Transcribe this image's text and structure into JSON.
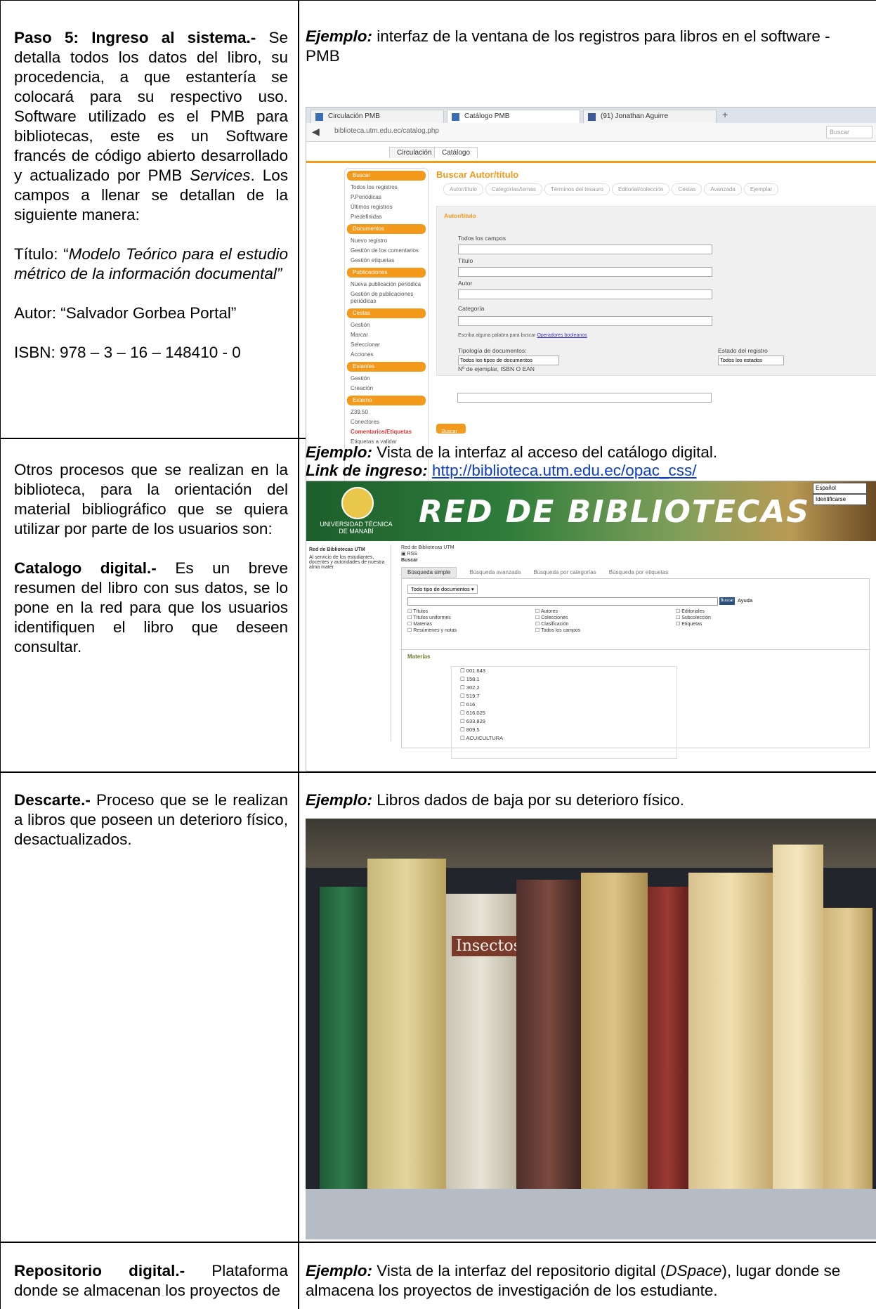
{
  "rows": [
    {
      "left": {
        "heading": "Paso 5: Ingreso al sistema.-",
        "text1": "Se detalla todos los datos del libro, su procedencia, a que estantería se colocará para su respectivo uso. Software utilizado es el PMB para bibliotecas, este es un Software francés de código abierto desarrollado y actualizado por PMB ",
        "text1_italic": "Services",
        "text1_end": ". Los campos a llenar se detallan de la siguiente manera:",
        "titulo_label": "Título: “",
        "titulo_value": "Modelo Teórico para el estudio métrico de la información documental”",
        "autor": "Autor: “Salvador Gorbea Portal”",
        "isbn": "ISBN: 978 – 3 – 16 – 148410 - 0"
      },
      "right": {
        "ex_label": "Ejemplo:",
        "ex_text": " interfaz de la ventana de los registros para libros en el software - PMB"
      }
    },
    {
      "left": {
        "intro": "Otros procesos que se realizan en la biblioteca, para la orientación del material bibliográfico que se quiera utilizar por parte de los usuarios son:",
        "heading": "Catalogo digital.-",
        "text": " Es un breve resumen del libro con sus datos, se lo pone en la red para que los usuarios identifiquen el libro que deseen consultar."
      },
      "right": {
        "ex_label": "Ejemplo:",
        "ex_text": " Vista de la interfaz al acceso del catálogo digital.",
        "link_label": "Link de ingreso:",
        "link": "http://biblioteca.utm.edu.ec/opac_css/"
      }
    },
    {
      "left": {
        "heading": "Descarte.-",
        "text": " Proceso que se le realizan a libros que poseen un deterioro físico, desactualizados."
      },
      "right": {
        "ex_label": "Ejemplo:",
        "ex_text": " Libros dados de baja por su deterioro físico."
      }
    },
    {
      "left": {
        "heading": "Repositorio digital.-",
        "text": " Plataforma donde se almacenan los proyectos de"
      },
      "right": {
        "ex_label": "Ejemplo:",
        "ex_text1": " Vista de la interfaz del repositorio digital (",
        "ex_italic": "DSpace",
        "ex_text2": "), lugar donde se almacena los proyectos de investigación de los estudiante."
      }
    }
  ],
  "pmb": {
    "browser_tabs": [
      "Circulación PMB",
      "Catálogo PMB",
      "(91) Jonathan Aguirre"
    ],
    "url": "biblioteca.utm.edu.ec/catalog.php",
    "search_placeholder": "Buscar",
    "top_tabs": [
      "Circulación",
      "Catálogo"
    ],
    "sidebar": [
      {
        "type": "h",
        "label": "Buscar"
      },
      {
        "type": "i",
        "label": "Todos los registros"
      },
      {
        "type": "i",
        "label": "P.Periódicas"
      },
      {
        "type": "i",
        "label": "Últimos registros"
      },
      {
        "type": "i",
        "label": "Predefinidas"
      },
      {
        "type": "h",
        "label": "Documentos"
      },
      {
        "type": "i",
        "label": "Nuevo registro"
      },
      {
        "type": "i",
        "label": "Gestión de los comentarios"
      },
      {
        "type": "i",
        "label": "Gestión etiquetas"
      },
      {
        "type": "h",
        "label": "Publicaciones"
      },
      {
        "type": "i",
        "label": "Nueva publicación periódica"
      },
      {
        "type": "i",
        "label": "Gestión de publicaciones periódicas"
      },
      {
        "type": "h",
        "label": "Cestas"
      },
      {
        "type": "i",
        "label": "Gestión"
      },
      {
        "type": "i",
        "label": "Marcar"
      },
      {
        "type": "i",
        "label": "Seleccionar"
      },
      {
        "type": "i",
        "label": "Acciones"
      },
      {
        "type": "h",
        "label": "Estantes"
      },
      {
        "type": "i",
        "label": "Gestión"
      },
      {
        "type": "i",
        "label": "Creación"
      },
      {
        "type": "h",
        "label": "Externo"
      },
      {
        "type": "i",
        "label": "Z39.50"
      },
      {
        "type": "i",
        "label": "Conectores"
      },
      {
        "type": "r",
        "label": "Comentarios/Etiquetas"
      },
      {
        "type": "i",
        "label": "Etiquetas a validar"
      }
    ],
    "title": "Buscar Autor/título",
    "subtabs": [
      "Autor/título",
      "Categorías/temas",
      "Términos del tesauro",
      "Editorial/colección",
      "Cestas",
      "Avanzada",
      "Ejemplar"
    ],
    "panel_title": "Autor/título",
    "fields": [
      "Todos los campos",
      "Título",
      "Autor",
      "Categoría"
    ],
    "hint": "Escriba alguna palabra para buscar",
    "hint_link": "Operadores booleanos",
    "tipologia_label": "Tipología de documentos:",
    "tipologia_value": "Todos los tipos de documentos",
    "estado_label": "Estado del registro",
    "estado_value": "Todos los estados",
    "ejemplar_label": "Nº de ejemplar, ISBN O EAN",
    "search_button": "Buscar"
  },
  "opac": {
    "lang": "Español",
    "ident": "Identificarse",
    "logo_text": "UNIVERSIDAD TÉCNICA DE MANABÍ",
    "banner_title": "RED DE BIBLIOTECAS",
    "left_title": "Red de Bibliotecas UTM",
    "left_text": "Al servicio de los estudiantes, docentes y autoridades de nuestra alma mater",
    "crumb1": "Red de Bibliotecas UTM",
    "crumb2": "RSS",
    "crumb3": "Buscar",
    "tabs": [
      "Búsqueda simple",
      "Búsqueda avanzada",
      "Búsqueda por categorías",
      "Búsqueda por etiquetas"
    ],
    "doc_type": "Todo tipo de documentos",
    "search_btn": "Buscar",
    "help": "Ayuda",
    "checks_col1": [
      "Títulos",
      "Títulos uniformes",
      "Materias",
      "Resúmenes y notas"
    ],
    "checks_col2": [
      "Autores",
      "Colecciones",
      "Clasificación",
      "Todos los campos"
    ],
    "checks_col3": [
      "Editoriales",
      "Subcolección",
      "Etiquetas"
    ],
    "materias_title": "Materias",
    "materias": [
      "001.643",
      "158.1",
      "302.2",
      "519.7",
      "616",
      "616.025",
      "633.829",
      "809.5",
      "ACUICULTURA"
    ]
  },
  "photo": {
    "book_label": "Insectos"
  }
}
